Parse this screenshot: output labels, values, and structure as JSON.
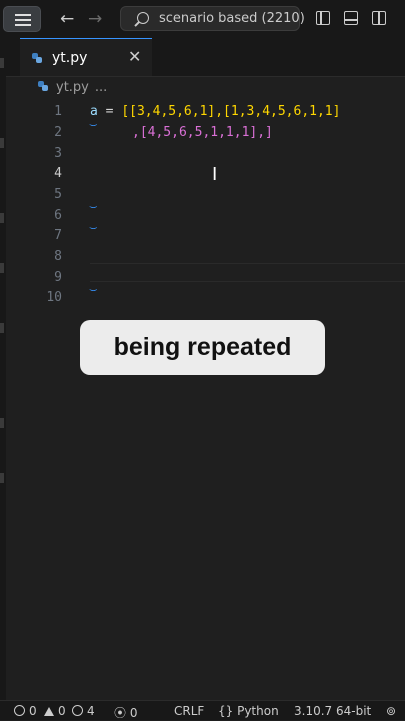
{
  "titlebar": {
    "search_text": "scenario based (2210)"
  },
  "tabs": [
    {
      "label": "yt.py",
      "close": "✕"
    }
  ],
  "breadcrumb": {
    "file": "yt.py",
    "more": "..."
  },
  "editor": {
    "line_numbers": [
      "1",
      "2",
      "3",
      "4",
      "5",
      "6",
      "7",
      "8",
      "9",
      "10"
    ],
    "active_line": "4",
    "code": {
      "line1_var": "a",
      "line1_eq": " = ",
      "line1_rest": "[[3,4,5,6,1],[1,3,4,5,6,1,1]",
      "line2": ",[4,5,6,5,1,1,1],]"
    }
  },
  "caption": "being repeated",
  "statusbar": {
    "errors": "0",
    "warnings": "0",
    "info": "4",
    "ports": "0",
    "eol": "CRLF",
    "language": "Python",
    "interpreter": "3.10.7 64-bit"
  },
  "colors": {
    "accent": "#3794ff",
    "bracket_gold": "#ffd700",
    "bracket_purple": "#da70d6",
    "number": "#b5cea8"
  }
}
